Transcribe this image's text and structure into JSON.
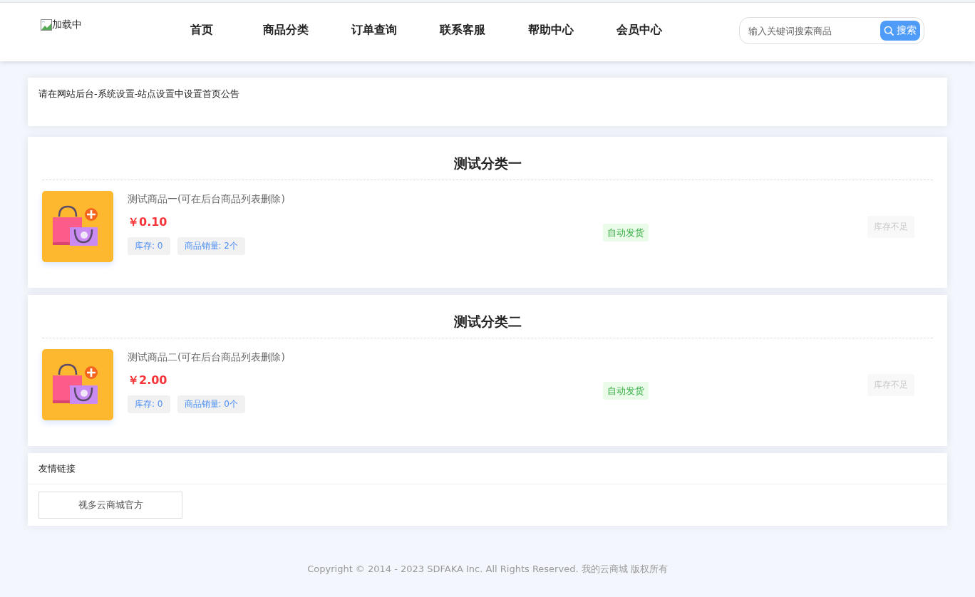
{
  "header": {
    "logo_alt": "加载中",
    "nav": [
      {
        "label": "首页"
      },
      {
        "label": "商品分类"
      },
      {
        "label": "订单查询"
      },
      {
        "label": "联系客服"
      },
      {
        "label": "帮助中心"
      },
      {
        "label": "会员中心"
      }
    ],
    "search": {
      "placeholder": "输入关键词搜索商品",
      "button": "搜索"
    }
  },
  "notice": "请在网站后台-系统设置-站点设置中设置首页公告",
  "categories": [
    {
      "title": "测试分类一",
      "products": [
        {
          "name": "测试商品一(可在后台商品列表删除)",
          "price": "￥0.10",
          "stock": "库存: 0",
          "sales": "商品销量: 2个",
          "delivery": "自动发货",
          "buy_label": "库存不足",
          "disabled": true
        }
      ]
    },
    {
      "title": "测试分类二",
      "products": [
        {
          "name": "测试商品二(可在后台商品列表删除)",
          "price": "￥2.00",
          "stock": "库存: 0",
          "sales": "商品销量: 0个",
          "delivery": "自动发货",
          "buy_label": "库存不足",
          "disabled": true
        }
      ]
    }
  ],
  "links": {
    "title": "友情链接",
    "items": [
      "视多云商城官方"
    ]
  },
  "footer": "Copyright © 2014 - 2023 SDFAKA Inc. All Rights Reserved. 我的云商城 版权所有"
}
